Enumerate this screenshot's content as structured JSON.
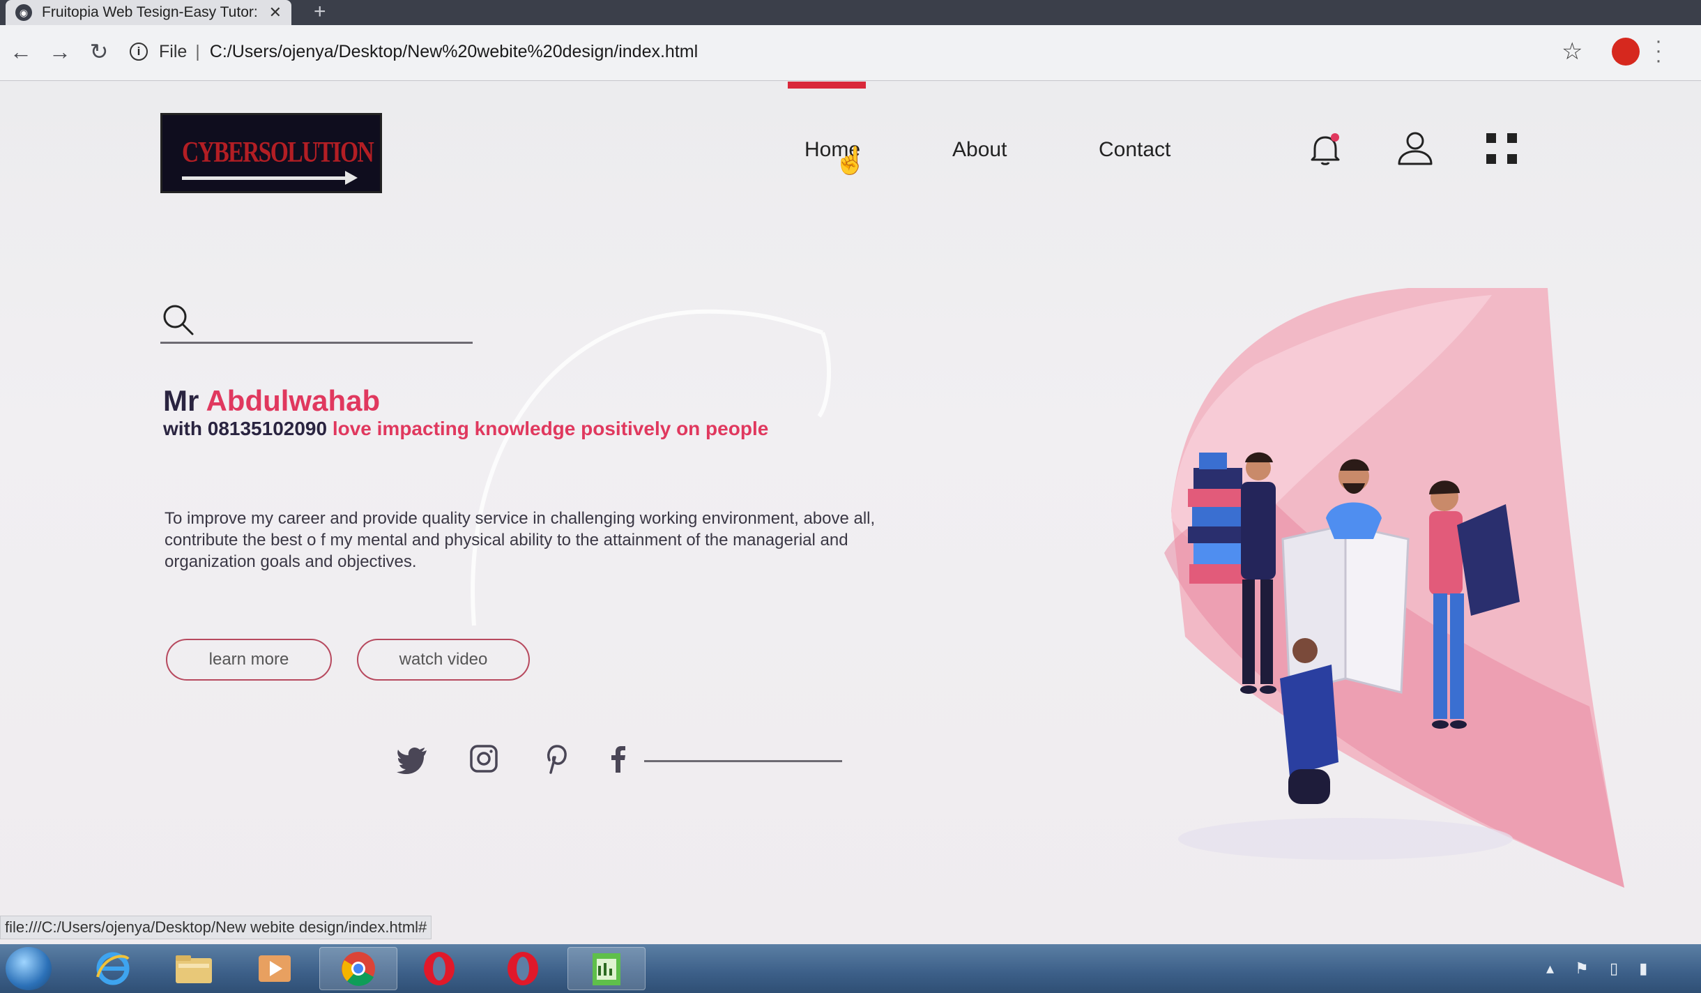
{
  "browser": {
    "tab_title": "Fruitopia Web Tesign-Easy Tutor:",
    "tab_close": "✕",
    "new_tab": "+",
    "address": {
      "scheme": "File",
      "separator": "|",
      "url": "C:/Users/ojenya/Desktop/New%20webite%20design/index.html"
    },
    "status_url": "file:///C:/Users/ojenya/Desktop/New webite design/index.html#"
  },
  "site": {
    "logo_text": "CYBERSOLUTION",
    "nav": {
      "home": "Home",
      "about": "About",
      "contact": "Contact"
    },
    "search": {
      "placeholder": "",
      "value": ""
    },
    "hero": {
      "name_prefix": "Mr",
      "name_highlight": "Abdulwahab",
      "sub_prefix": "with 08135102090",
      "sub_highlight": "love impacting knowledge positively on people",
      "description": "To improve my career and provide quality service in challenging working environment, above all, contribute the best o f my mental and physical ability to the attainment of the managerial and organization goals and objectives."
    },
    "buttons": {
      "learn_more": "learn more",
      "watch_video": "watch video"
    },
    "social_icons": [
      "twitter-icon",
      "instagram-icon",
      "pinterest-icon",
      "facebook-icon"
    ]
  },
  "colors": {
    "accent": "#e0385e",
    "dark_text": "#2a2440",
    "indicator": "#d9283a",
    "logo_bg": "#0f0d1e",
    "logo_text": "#b31e24"
  },
  "taskbar": {
    "items": [
      "start",
      "internet-explorer",
      "file-explorer",
      "media-player",
      "chrome",
      "opera",
      "opera",
      "app"
    ]
  }
}
